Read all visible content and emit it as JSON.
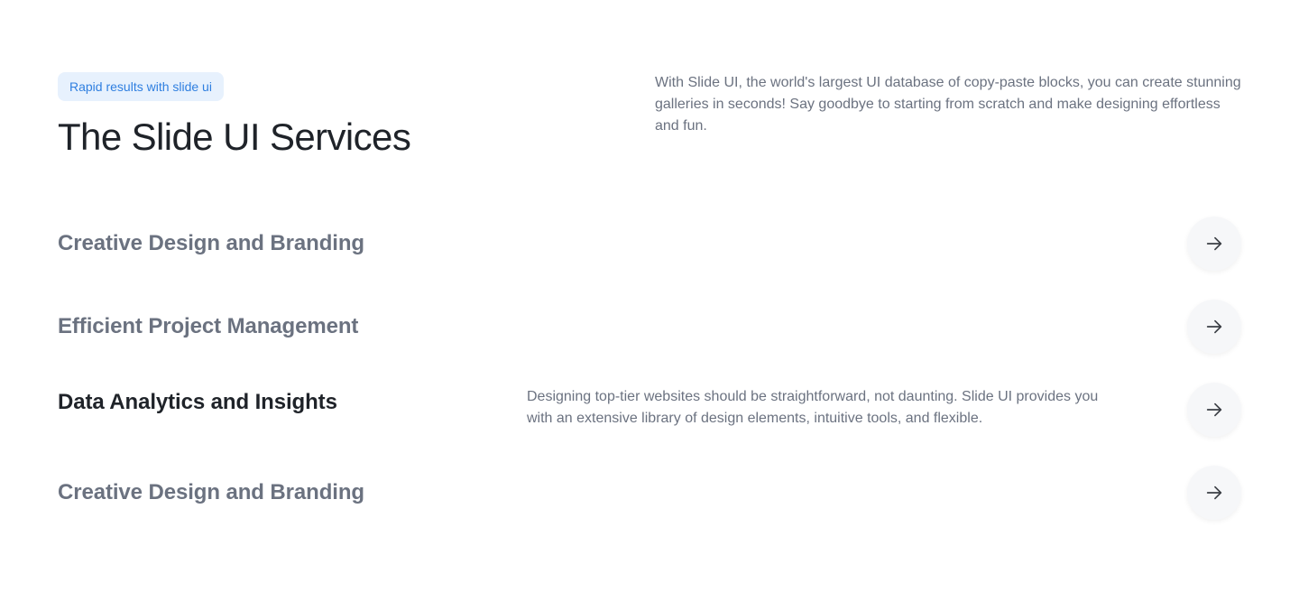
{
  "header": {
    "badge": "Rapid results with slide ui",
    "title": "The Slide UI Services",
    "intro": "With Slide UI, the world's largest UI database of copy-paste blocks, you can create stunning galleries in seconds! Say goodbye to starting from scratch and make designing effortless and fun."
  },
  "services": [
    {
      "label": "Creative Design and Branding",
      "active": false,
      "icon": "arrow-right-icon"
    },
    {
      "label": "Efficient Project Management",
      "active": false,
      "icon": "arrow-right-icon"
    },
    {
      "label": "Data Analytics and Insights",
      "active": true,
      "icon": "arrow-right-icon",
      "description": "Designing top-tier websites should be straightforward, not daunting. Slide UI provides you with an extensive library of design elements, intuitive tools, and flexible."
    },
    {
      "label": "Creative Design and Branding",
      "active": false,
      "icon": "arrow-right-icon"
    }
  ],
  "colors": {
    "accent": "#2f7fe0",
    "badge_bg": "#e7f1fd",
    "heading": "#1f2329",
    "muted": "#6b7280",
    "button_bg": "#f6f7f9"
  }
}
